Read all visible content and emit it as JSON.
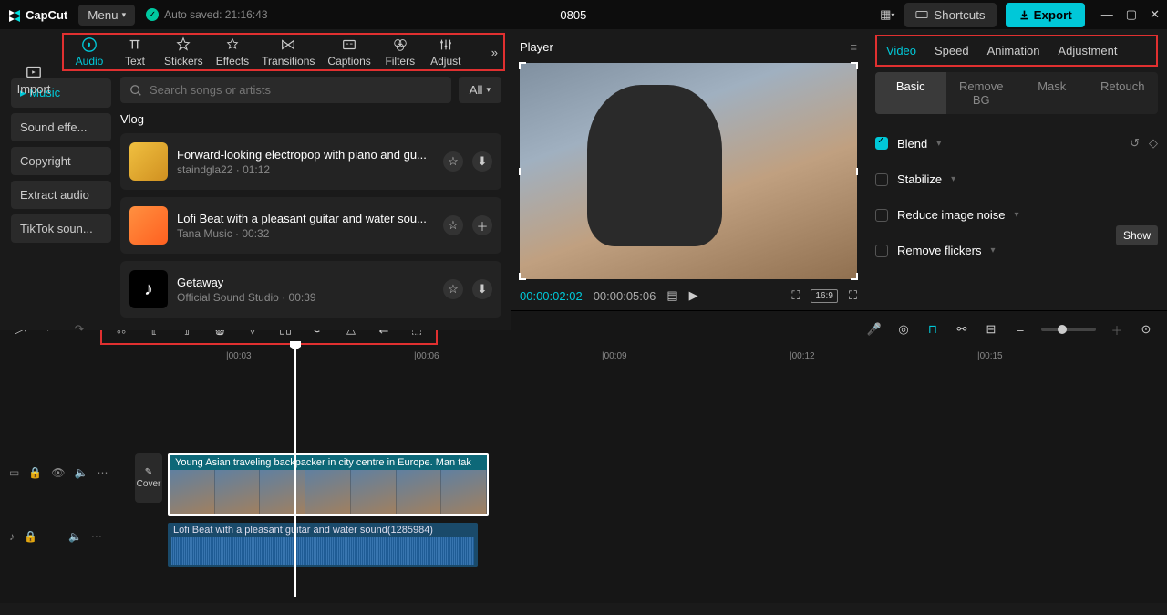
{
  "app": {
    "name": "CapCut",
    "menu": "Menu",
    "autosave": "Auto saved: 21:16:43",
    "project": "0805"
  },
  "titlebar": {
    "shortcuts": "Shortcuts",
    "export": "Export"
  },
  "media_tabs": {
    "import": "Import",
    "items": [
      "Audio",
      "Text",
      "Stickers",
      "Effects",
      "Transitions",
      "Captions",
      "Filters",
      "Adjust"
    ],
    "active": "Audio"
  },
  "sidebar": {
    "items": [
      {
        "label": "Music",
        "active": true
      },
      {
        "label": "Sound effe..."
      },
      {
        "label": "Copyright"
      },
      {
        "label": "Extract audio"
      },
      {
        "label": "TikTok soun..."
      }
    ]
  },
  "search": {
    "placeholder": "Search songs or artists",
    "all": "All"
  },
  "section": "Vlog",
  "tracks": [
    {
      "title": "Forward-looking electropop with piano and gu...",
      "artist": "staindgla22",
      "duration": "01:12",
      "fav": true,
      "add": "download"
    },
    {
      "title": "Lofi Beat with a pleasant guitar and water sou...",
      "artist": "Tana Music",
      "duration": "00:32",
      "fav": true,
      "add": "plus"
    },
    {
      "title": "Getaway",
      "artist": "Official Sound Studio",
      "duration": "00:39",
      "fav": true,
      "add": "download"
    }
  ],
  "player": {
    "title": "Player",
    "current": "00:00:02:02",
    "total": "00:00:05:06",
    "ratio": "16:9"
  },
  "inspector": {
    "tabs": [
      "Video",
      "Speed",
      "Animation",
      "Adjustment"
    ],
    "active": "Video",
    "subtabs": [
      "Basic",
      "Remove BG",
      "Mask",
      "Retouch"
    ],
    "sub_active": "Basic",
    "sections": [
      {
        "label": "Blend",
        "checked": true,
        "icons": true
      },
      {
        "label": "Stabilize",
        "checked": false
      },
      {
        "label": "Reduce image noise",
        "checked": false
      },
      {
        "label": "Remove flickers",
        "checked": false,
        "tooltip": "Show"
      }
    ]
  },
  "timeline": {
    "ruler": [
      "|00:03",
      "|00:06",
      "|00:09",
      "|00:12",
      "|00:15"
    ],
    "video_clip": "Young Asian traveling backpacker in city centre in Europe. Man tak",
    "audio_clip": "Lofi Beat with a pleasant guitar and water sound(1285984)",
    "cover": "Cover"
  }
}
